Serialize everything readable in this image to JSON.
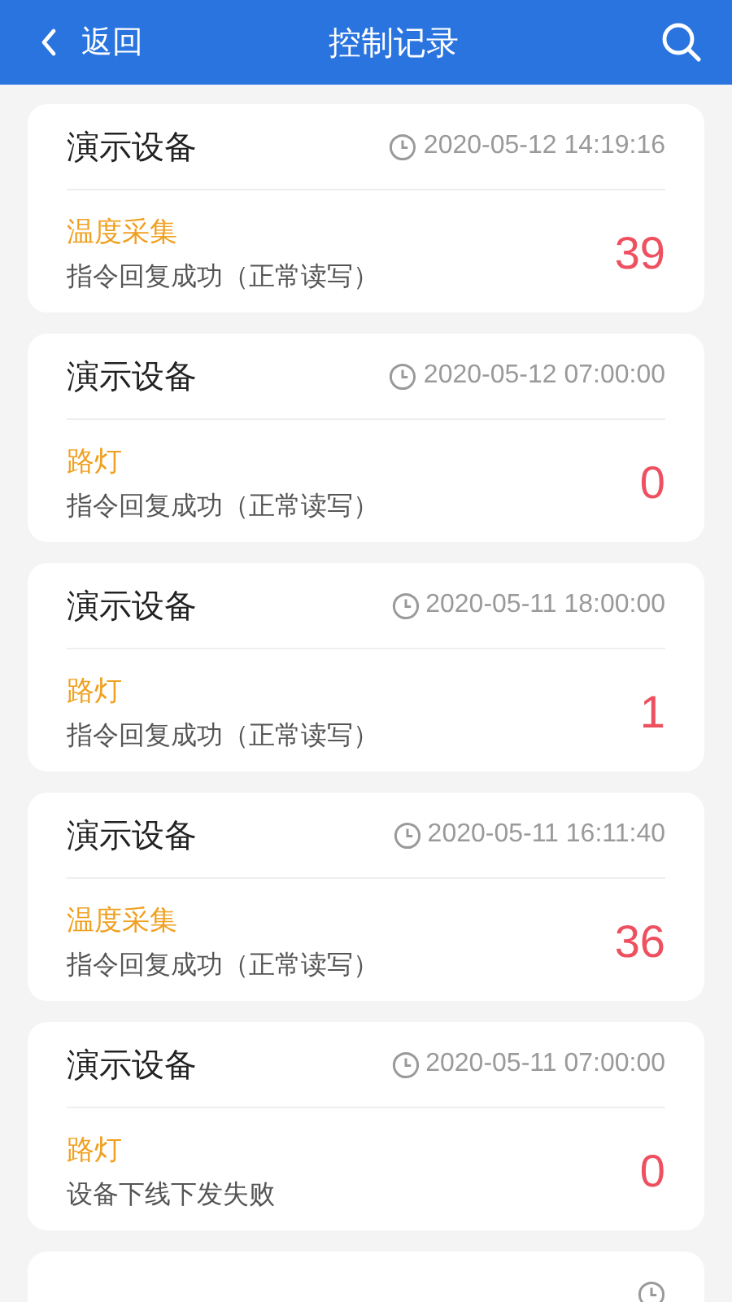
{
  "header": {
    "back_label": "返回",
    "title": "控制记录"
  },
  "records": [
    {
      "device": "演示设备",
      "time": "2020-05-12 14:19:16",
      "type": "温度采集",
      "status": "指令回复成功（正常读写）",
      "value": "39"
    },
    {
      "device": "演示设备",
      "time": "2020-05-12 07:00:00",
      "type": "路灯",
      "status": "指令回复成功（正常读写）",
      "value": "0"
    },
    {
      "device": "演示设备",
      "time": "2020-05-11 18:00:00",
      "type": "路灯",
      "status": "指令回复成功（正常读写）",
      "value": "1"
    },
    {
      "device": "演示设备",
      "time": "2020-05-11 16:11:40",
      "type": "温度采集",
      "status": "指令回复成功（正常读写）",
      "value": "36"
    },
    {
      "device": "演示设备",
      "time": "2020-05-11 07:00:00",
      "type": "路灯",
      "status": "设备下线下发失败",
      "value": "0"
    },
    {
      "kind": "partial"
    }
  ]
}
